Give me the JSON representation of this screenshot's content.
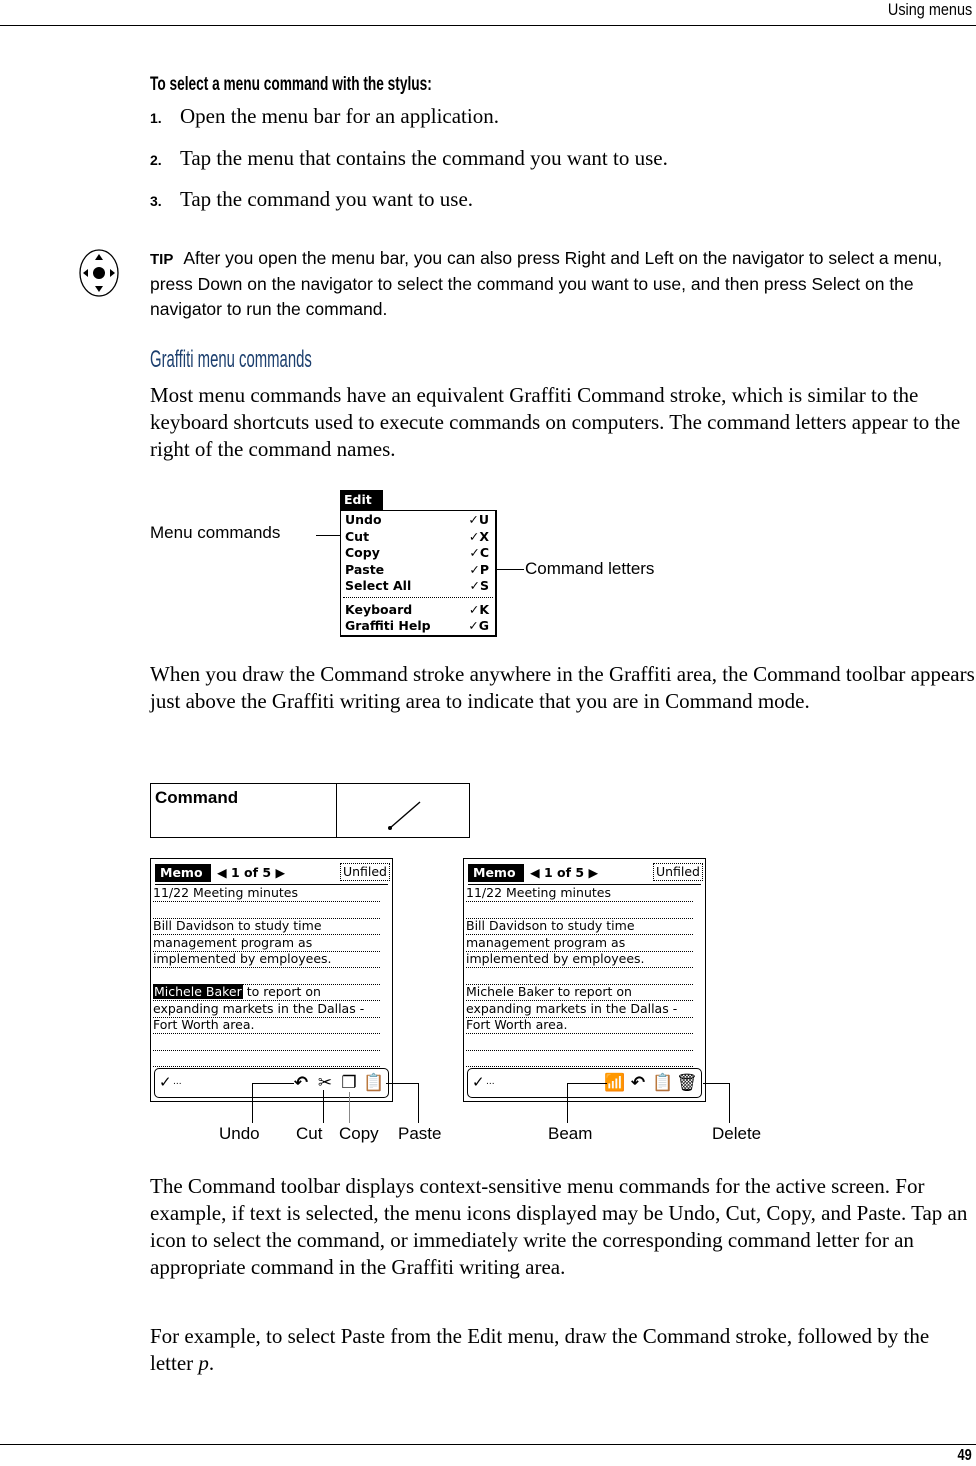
{
  "header": {
    "chapter_title": "Using menus"
  },
  "footer": {
    "page_number": "49"
  },
  "procedure": {
    "heading": "To select a menu command with the stylus:",
    "steps": [
      {
        "num": "1.",
        "text": "Open the menu bar for an application."
      },
      {
        "num": "2.",
        "text": "Tap the menu that contains the command you want to use."
      },
      {
        "num": "3.",
        "text": "Tap the command you want to use."
      }
    ]
  },
  "tip": {
    "icon": "navigator-icon",
    "label": "TIP",
    "text": "After you open the menu bar, you can also press Right and Left on the navigator to select a menu, press Down on the navigator to select the command you want to use, and then press Select on the navigator to run the command."
  },
  "section": {
    "heading": "Graffiti menu commands",
    "intro": "Most menu commands have an equivalent Graffiti Command stroke, which is similar to the keyboard shortcuts used to execute commands on computers. The command letters appear to the right of the command names."
  },
  "edit_menu_figure": {
    "callout_left": "Menu commands",
    "callout_right": "Command letters",
    "menu_title": "Edit",
    "items": [
      {
        "label": "Undo",
        "shortcut": "U"
      },
      {
        "label": "Cut",
        "shortcut": "X"
      },
      {
        "label": "Copy",
        "shortcut": "C"
      },
      {
        "label": "Paste",
        "shortcut": "P"
      },
      {
        "label": "Select All",
        "shortcut": "S"
      },
      {
        "label": "Keyboard",
        "shortcut": "K"
      },
      {
        "label": "Graffiti Help",
        "shortcut": "G"
      }
    ],
    "stroke_glyph": "✓"
  },
  "para_command_mode": "When you draw the Command stroke anywhere in the Graffiti area, the Command toolbar appears just above the Graffiti writing area to indicate that you are in Command mode.",
  "command_table": {
    "label": "Command",
    "stroke_icon": "command-stroke-icon"
  },
  "memo_screens": {
    "app_tab": "Memo",
    "pager": "1 of 5",
    "category": "Unfiled",
    "lines": [
      "11/22 Meeting minutes",
      "",
      "Bill Davidson to study time",
      "management program as",
      "implemented by employees.",
      "",
      "Michele Baker",
      "expanding markets in the Dallas -",
      "Fort Worth area.",
      "",
      ""
    ],
    "line7_rest": " to report on",
    "line7_full": "Michele Baker to report on",
    "toolbar_check": "✓",
    "toolbar_ellipsis": "...",
    "left_icons": [
      "undo-icon",
      "cut-icon",
      "copy-icon",
      "paste-icon"
    ],
    "right_icons": [
      "beam-icon",
      "undo-icon",
      "paste-icon",
      "delete-icon"
    ],
    "callouts_left": [
      "Undo",
      "Cut",
      "Copy",
      "Paste"
    ],
    "callouts_right": [
      "Beam",
      "Delete"
    ]
  },
  "para_toolbar": "The Command toolbar displays context-sensitive menu commands for the active screen. For example, if text is selected, the menu icons displayed may be Undo, Cut, Copy, and Paste. Tap an icon to select the command, or immediately write the corresponding command letter for an appropriate command in the Graffiti writing area.",
  "para_example_prefix": "For example, to select Paste from the Edit menu, draw the Command stroke, followed by the letter ",
  "para_example_letter": "p",
  "para_example_suffix": ".",
  "colors": {
    "section_heading": "#1c3f6e"
  }
}
